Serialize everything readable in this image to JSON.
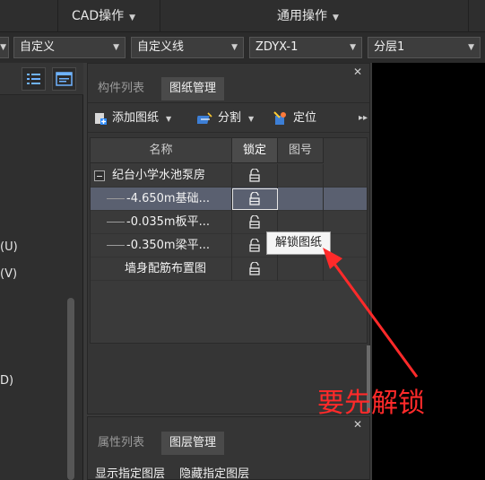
{
  "topbar": {
    "menus": [
      {
        "label": "CAD操作"
      },
      {
        "label": "通用操作"
      }
    ]
  },
  "filterbar": {
    "combos": [
      {
        "value": "自定义"
      },
      {
        "value": "自定义线"
      },
      {
        "value": "ZDYX-1"
      },
      {
        "value": "分层1"
      }
    ]
  },
  "left_panel": {
    "labels": [
      "(U)",
      "(V)",
      "D)"
    ]
  },
  "drawing_panel": {
    "tabs": [
      {
        "label": "构件列表",
        "active": false
      },
      {
        "label": "图纸管理",
        "active": true
      }
    ],
    "toolbar": {
      "add": "添加图纸",
      "split": "分割",
      "locate": "定位"
    },
    "columns": [
      "名称",
      "锁定",
      "图号"
    ],
    "rows": [
      {
        "name": "纪台小学水池泵房",
        "type": "parent"
      },
      {
        "name": "-4.650m基础...",
        "type": "child",
        "selected": true
      },
      {
        "name": "-0.035m板平...",
        "type": "child"
      },
      {
        "name": "-0.350m梁平...",
        "type": "child"
      },
      {
        "name": "墙身配筋布置图",
        "type": "plain"
      }
    ],
    "tooltip": "解锁图纸"
  },
  "annotation": {
    "text": "要先解锁",
    "color": "#ff2a2a"
  },
  "bottom_panel": {
    "tabs": [
      {
        "label": "属性列表",
        "active": false
      },
      {
        "label": "图层管理",
        "active": true
      }
    ],
    "links": [
      "显示指定图层",
      "隐藏指定图层"
    ]
  }
}
